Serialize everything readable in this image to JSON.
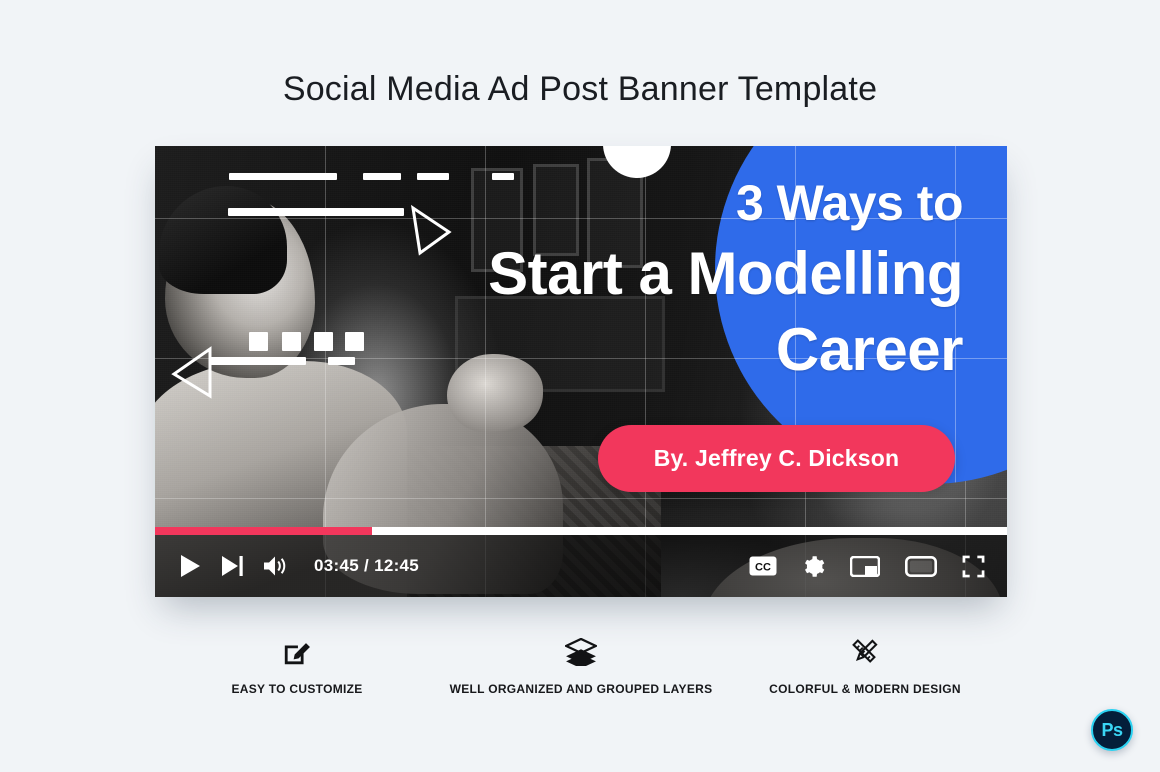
{
  "page": {
    "title": "Social Media Ad Post Banner Template",
    "background_color": "#F1F4F7"
  },
  "banner": {
    "headline_line1": "3 Ways to",
    "headline_line2": "Start a Modelling",
    "headline_line3": "Career",
    "author_label": "By. Jeffrey C. Dickson",
    "accent_blue": "#2F6BEA",
    "accent_purple": "#5A1ED1",
    "accent_pink": "#F2375C"
  },
  "player": {
    "progress_percent": 25.5,
    "current_time": "03:45",
    "separator": "/",
    "total_time": "12:45",
    "controls_left": [
      {
        "name": "play-button",
        "icon": "play-icon"
      },
      {
        "name": "next-button",
        "icon": "next-track-icon"
      },
      {
        "name": "volume-button",
        "icon": "volume-icon"
      }
    ],
    "controls_right": [
      {
        "name": "captions-button",
        "icon": "cc-icon",
        "label": "CC"
      },
      {
        "name": "settings-button",
        "icon": "gear-icon"
      },
      {
        "name": "miniplayer-button",
        "icon": "miniplayer-icon"
      },
      {
        "name": "theater-button",
        "icon": "theater-mode-icon"
      },
      {
        "name": "fullscreen-button",
        "icon": "fullscreen-icon"
      }
    ]
  },
  "features": [
    {
      "icon": "edit-pencil-icon",
      "label": "EASY TO CUSTOMIZE"
    },
    {
      "icon": "layers-icon",
      "label": "WELL ORGANIZED AND GROUPED LAYERS"
    },
    {
      "icon": "ruler-pencil-icon",
      "label": "COLORFUL & MODERN DESIGN"
    }
  ],
  "badge": {
    "label": "Ps",
    "name": "photoshop-badge",
    "ring_color": "#2AD2F2",
    "fill_color": "#041E3A"
  }
}
